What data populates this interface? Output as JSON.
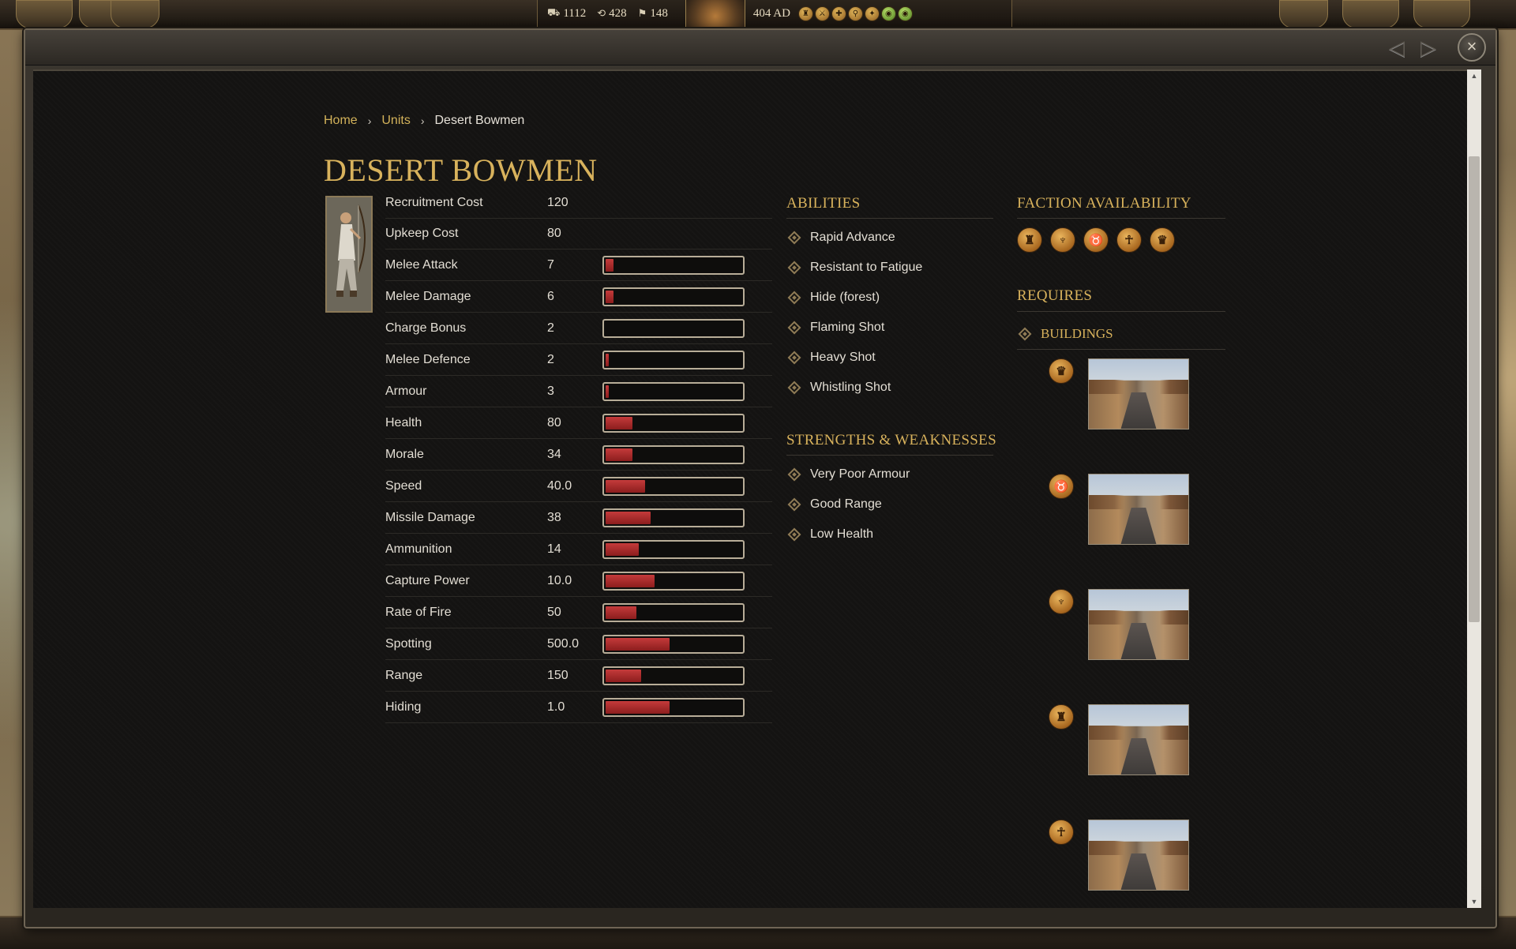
{
  "hud": {
    "resources": [
      {
        "icon": "food-icon",
        "glyph": "⛟",
        "value": "1112"
      },
      {
        "icon": "growth-icon",
        "glyph": "⟲",
        "value": "428"
      },
      {
        "icon": "manpower-icon",
        "glyph": "⚑",
        "value": "148"
      }
    ],
    "turn": "404 AD",
    "status_icons": [
      "banner-icon",
      "army-icon",
      "religion-icon",
      "search-icon",
      "sword-icon",
      "green-eye-icon",
      "green-eye-icon"
    ]
  },
  "breadcrumb": {
    "home": "Home",
    "units": "Units",
    "current": "Desert Bowmen"
  },
  "title": "DESERT BOWMEN",
  "stats": [
    {
      "label": "Recruitment Cost",
      "value": "120",
      "bar": null
    },
    {
      "label": "Upkeep Cost",
      "value": "80",
      "bar": null
    },
    {
      "label": "Melee Attack",
      "value": "7",
      "bar": 0.06
    },
    {
      "label": "Melee Damage",
      "value": "6",
      "bar": 0.06
    },
    {
      "label": "Charge Bonus",
      "value": "2",
      "bar": 0.0
    },
    {
      "label": "Melee Defence",
      "value": "2",
      "bar": 0.02
    },
    {
      "label": "Armour",
      "value": "3",
      "bar": 0.02
    },
    {
      "label": "Health",
      "value": "80",
      "bar": 0.2
    },
    {
      "label": "Morale",
      "value": "34",
      "bar": 0.2
    },
    {
      "label": "Speed",
      "value": "40.0",
      "bar": 0.3
    },
    {
      "label": "Missile Damage",
      "value": "38",
      "bar": 0.34
    },
    {
      "label": "Ammunition",
      "value": "14",
      "bar": 0.25
    },
    {
      "label": "Capture Power",
      "value": "10.0",
      "bar": 0.37
    },
    {
      "label": "Rate of Fire",
      "value": "50",
      "bar": 0.23
    },
    {
      "label": "Spotting",
      "value": "500.0",
      "bar": 0.48
    },
    {
      "label": "Range",
      "value": "150",
      "bar": 0.27
    },
    {
      "label": "Hiding",
      "value": "1.0",
      "bar": 0.48
    }
  ],
  "abilities": {
    "title": "ABILITIES",
    "items": [
      "Rapid Advance",
      "Resistant to Fatigue",
      "Hide (forest)",
      "Flaming Shot",
      "Heavy Shot",
      "Whistling Shot"
    ]
  },
  "strengths": {
    "title": "STRENGTHS & WEAKNESSES",
    "items": [
      "Very Poor Armour",
      "Good Range",
      "Low Health"
    ]
  },
  "faction": {
    "title": "FACTION AVAILABILITY",
    "icons": [
      {
        "name": "faction-pillar-icon",
        "glyph": "♜"
      },
      {
        "name": "faction-crest-icon",
        "glyph": "♆"
      },
      {
        "name": "faction-bull-icon",
        "glyph": "♉"
      },
      {
        "name": "faction-deity-icon",
        "glyph": "☥"
      },
      {
        "name": "faction-mask-icon",
        "glyph": "♛"
      }
    ]
  },
  "requires": {
    "title": "REQUIRES",
    "buildings_label": "BUILDINGS",
    "buildings": [
      {
        "badge": "faction-mask-icon",
        "glyph": "♛"
      },
      {
        "badge": "faction-bull-icon",
        "glyph": "♉"
      },
      {
        "badge": "faction-crest-icon",
        "glyph": "♆"
      },
      {
        "badge": "faction-pillar-icon",
        "glyph": "♜"
      },
      {
        "badge": "faction-deity-icon",
        "glyph": "☥"
      }
    ]
  }
}
